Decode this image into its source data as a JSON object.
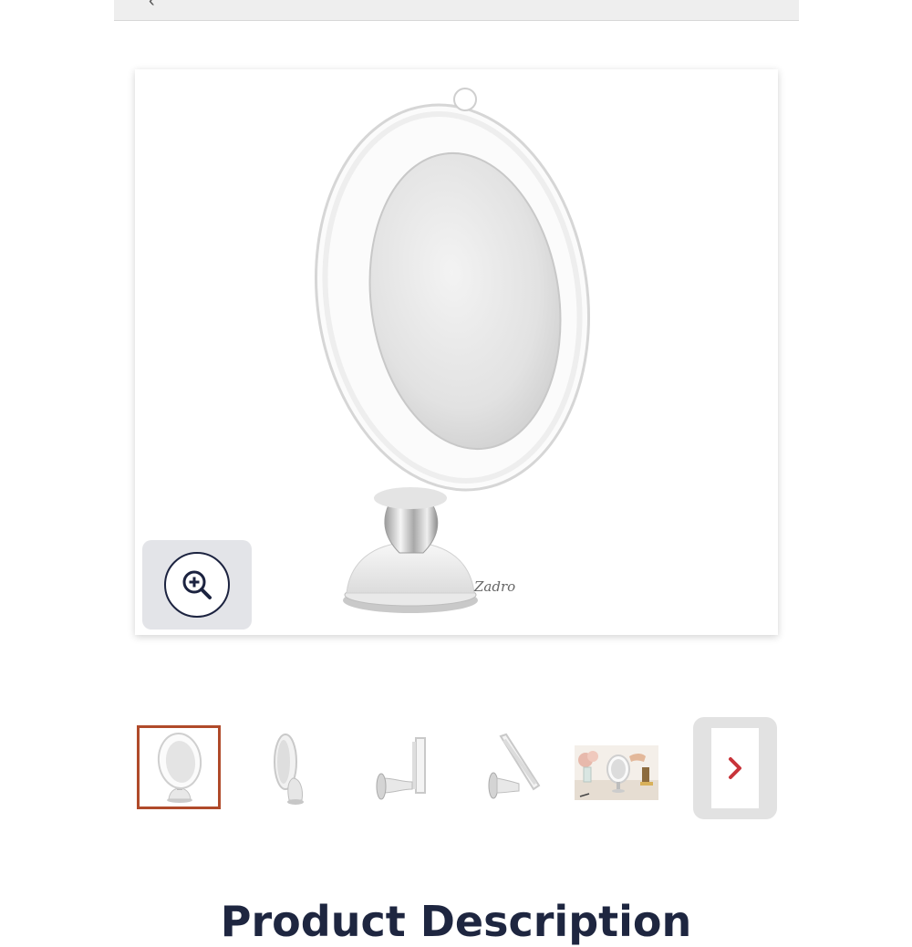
{
  "header": {
    "back_glyph": "‹"
  },
  "gallery": {
    "brand_logo_text": "Zadro",
    "zoom_button_icon": "zoom-in-icon",
    "thumbnails": [
      {
        "alt": "mirror-front-view",
        "selected": true
      },
      {
        "alt": "mirror-side-view",
        "selected": false
      },
      {
        "alt": "mirror-wall-mount-view",
        "selected": false
      },
      {
        "alt": "mirror-tilted-view",
        "selected": false
      },
      {
        "alt": "mirror-lifestyle-view",
        "selected": false
      }
    ],
    "next_icon": "chevron-right-icon"
  },
  "description": {
    "heading": "Product Description"
  },
  "colors": {
    "selected_border": "#b04a2a",
    "next_chevron": "#c8343a",
    "zoom_icon": "#1c2340",
    "heading": "#1e2640"
  }
}
